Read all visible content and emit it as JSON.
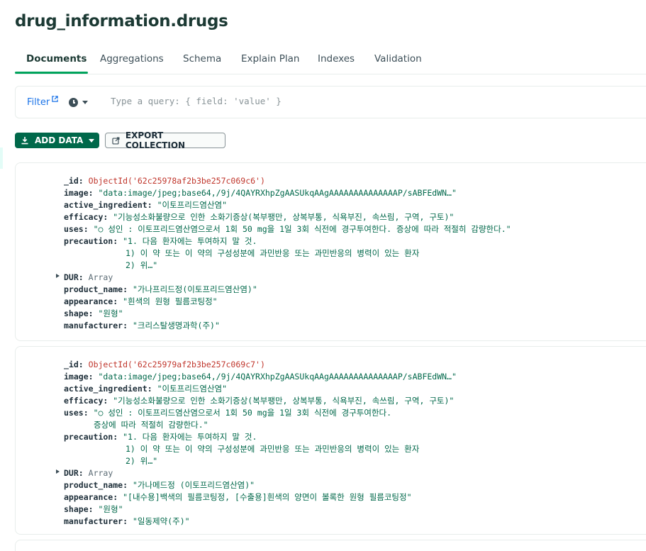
{
  "title": "drug_information.drugs",
  "tabs": [
    "Documents",
    "Aggregations",
    "Schema",
    "Explain Plan",
    "Indexes",
    "Validation"
  ],
  "filter": {
    "label": "Filter",
    "placeholder": "Type a query: { field: 'value' }"
  },
  "toolbar": {
    "add_data": "ADD DATA",
    "export": "EXPORT COLLECTION"
  },
  "documents": [
    {
      "id_key": "_id:",
      "id_val": "ObjectId('62c25978af2b3be257c069c6')",
      "image_key": "image:",
      "image_val": "\"data:image/jpeg;base64,/9j/4QAYRXhpZgAASUkqAAgAAAAAAAAAAAAAAP/sABFEdWN…\"",
      "ai_key": "active_ingredient:",
      "ai_val": "\"이토프리드염산염\"",
      "eff_key": "efficacy:",
      "eff_val": "\"기능성소화불량으로 인한 소화기증상(복부팽만, 상복부통, 식욕부진, 속쓰림, 구역, 구토)\"",
      "uses_key": "uses:",
      "uses_val1": "\"○ 성인 : 이토프리드염산염으로서 1회 50 mg을 1일 3회 식전에 경구투여한다. 증상에 따라 적절히 감량한다.\"",
      "uses_val2": "",
      "prec_key": "precaution:",
      "prec_val1": "\"1. 다음 환자에는 투여하지 말 것.",
      "prec_val2": "1) 이 약 또는 이 약의 구성성분에 과민반응 또는 과민반응의 병력이 있는 환자",
      "prec_val3": "2) 위…\"",
      "dur_key": "DUR:",
      "dur_val": "Array",
      "pn_key": "product_name:",
      "pn_val": "\"가나프리드정(이토프리드염산염)\"",
      "app_key": "appearance:",
      "app_val": "\"흰색의 원형 필름코팅정\"",
      "shape_key": "shape:",
      "shape_val": "\"원형\"",
      "mf_key": "manufacturer:",
      "mf_val": "\"크리스탈생명과학(주)\""
    },
    {
      "id_key": "_id:",
      "id_val": "ObjectId('62c25979af2b3be257c069c7')",
      "image_key": "image:",
      "image_val": "\"data:image/jpeg;base64,/9j/4QAYRXhpZgAASUkqAAgAAAAAAAAAAAAAAP/sABFEdWN…\"",
      "ai_key": "active_ingredient:",
      "ai_val": "\"이토프리드염산염\"",
      "eff_key": "efficacy:",
      "eff_val": "\"기능성소화불량으로 인한 소화기증상(복부팽만, 상복부통, 식욕부진, 속쓰림, 구역, 구토)\"",
      "uses_key": "uses:",
      "uses_val1": "\"○ 성인 : 이토프리드염산염으로서 1회 50 mg을 1일 3회 식전에 경구투여한다.",
      "uses_val2": "증상에 따라 적절히 감량한다.\"",
      "prec_key": "precaution:",
      "prec_val1": "\"1. 다음 환자에는 투여하지 말 것.",
      "prec_val2": "1) 이 약 또는 이 약의 구성성분에 과민반응 또는 과민반응의 병력이 있는 환자",
      "prec_val3": "2) 위…\"",
      "dur_key": "DUR:",
      "dur_val": "Array",
      "pn_key": "product_name:",
      "pn_val": "\"가나메드정 (이토프리드염산염)\"",
      "app_key": "appearance:",
      "app_val": "\"[내수용]백색의 필름코팅정, [수출용]흰색의 양면이 볼록한 원형 필름코팅정\"",
      "shape_key": "shape:",
      "shape_val": "\"원형\"",
      "mf_key": "manufacturer:",
      "mf_val": "\"일동제약(주)\""
    }
  ]
}
